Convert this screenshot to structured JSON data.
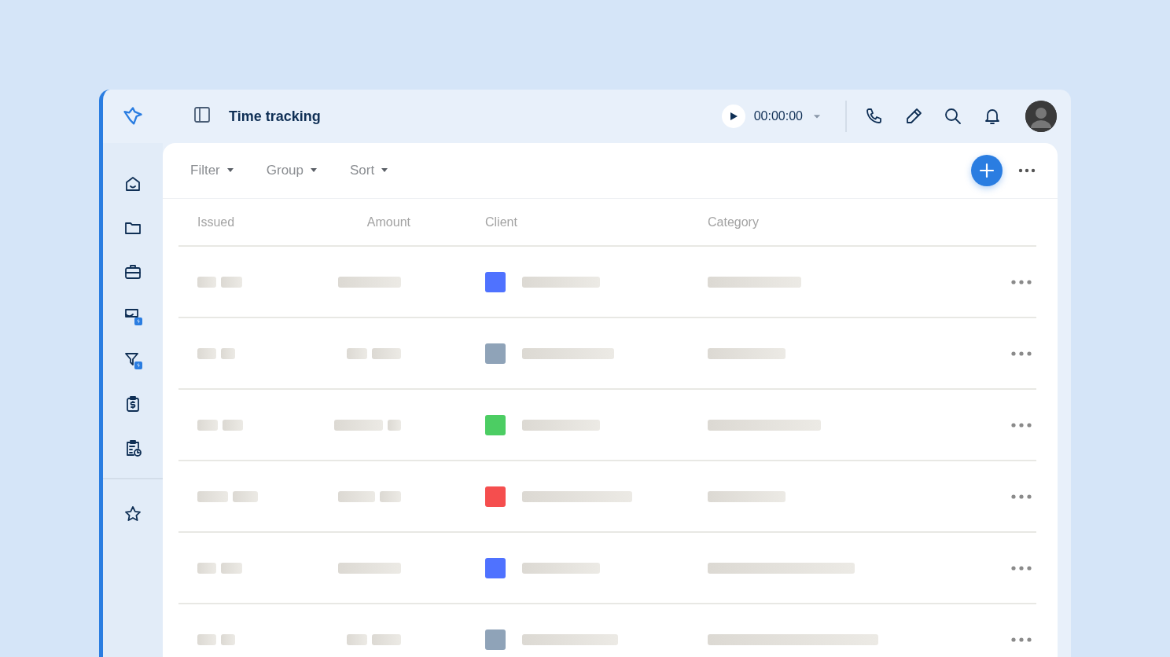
{
  "header": {
    "title": "Time tracking",
    "timer": "00:00:00"
  },
  "toolbar": {
    "controls": [
      {
        "label": "Filter"
      },
      {
        "label": "Group"
      },
      {
        "label": "Sort"
      }
    ]
  },
  "table": {
    "columns": [
      "Issued",
      "Amount",
      "Client",
      "Category"
    ],
    "rows": [
      {
        "color": "#4f72ff"
      },
      {
        "color": "#8fa3b8"
      },
      {
        "color": "#4ccd63"
      },
      {
        "color": "#f54e4e"
      },
      {
        "color": "#4f72ff"
      },
      {
        "color": "#8fa3b8"
      }
    ]
  }
}
